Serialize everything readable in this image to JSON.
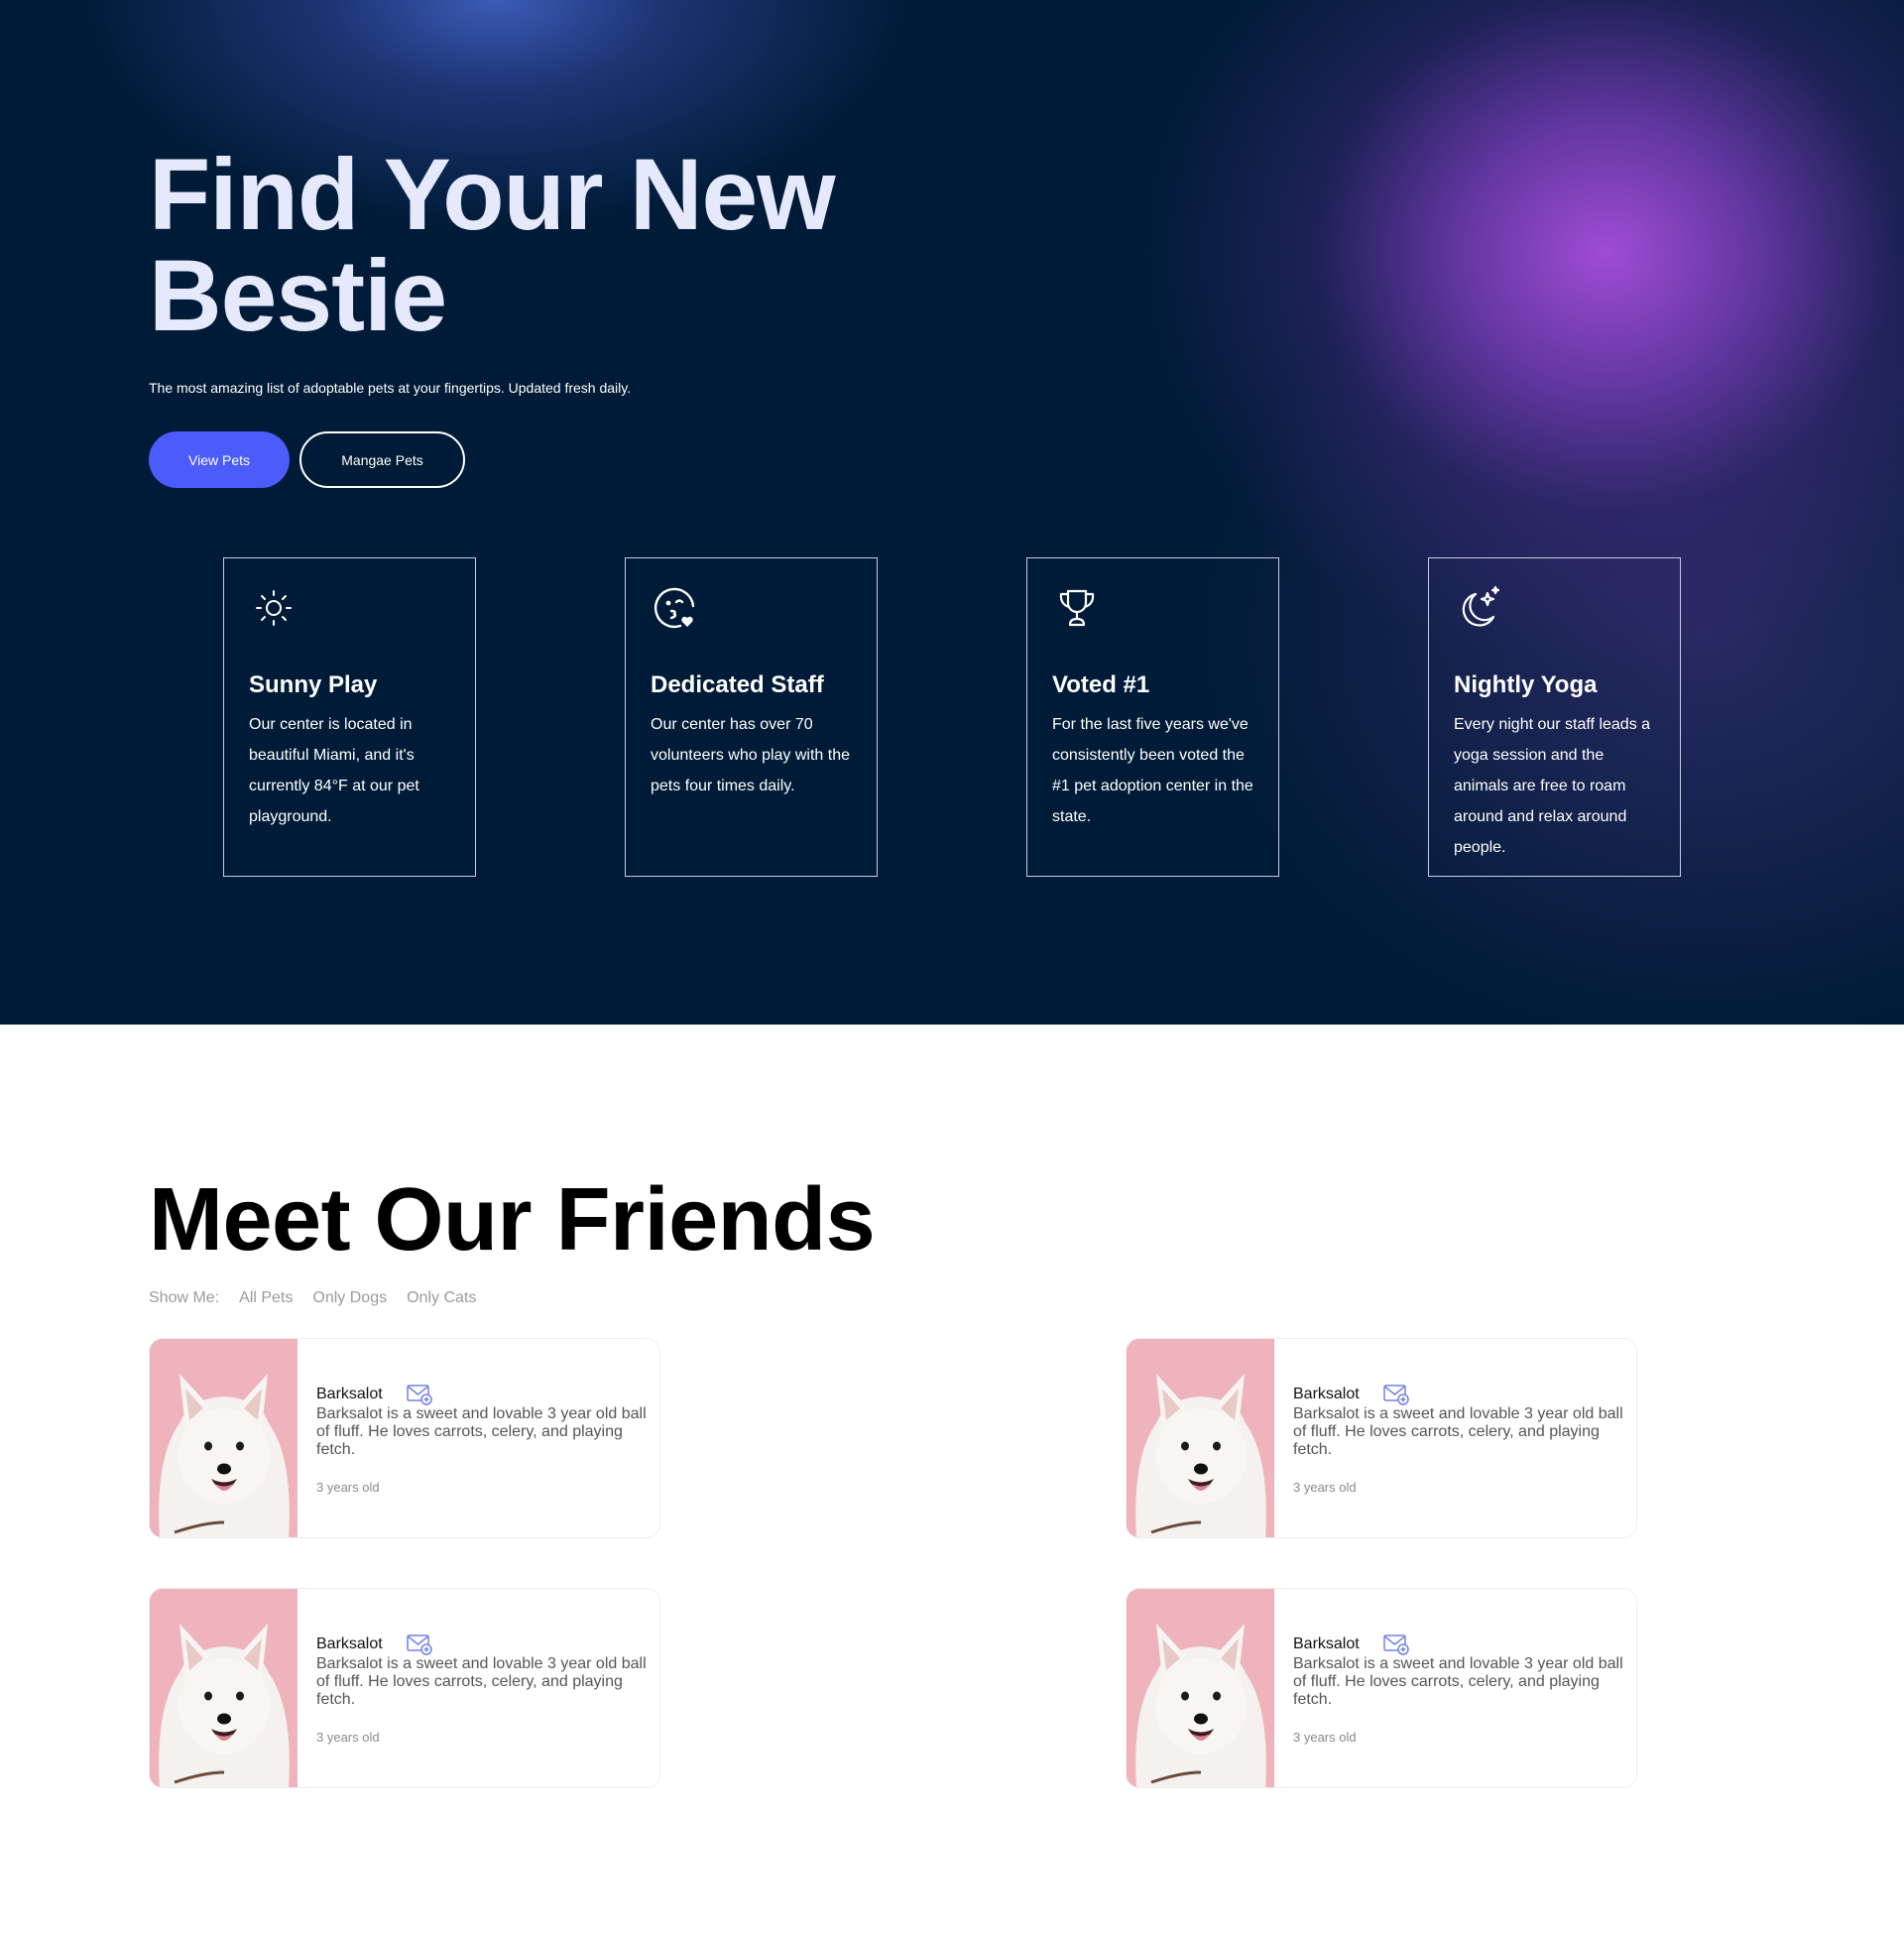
{
  "hero": {
    "title_line1": "Find Your New",
    "title_line2": "Bestie",
    "subtitle": "The most amazing list of adoptable pets at your fingertips. Updated fresh daily.",
    "primary_button": "View Pets",
    "secondary_button": "Mangae Pets"
  },
  "features": [
    {
      "icon": "sun-icon",
      "title": "Sunny Play",
      "text": "Our center is located in beautiful Miami, and it's currently 84°F at our pet playground."
    },
    {
      "icon": "kiss-heart-face-icon",
      "title": "Dedicated Staff",
      "text": "Our center has over 70 volunteers who play with the pets four times daily."
    },
    {
      "icon": "trophy-icon",
      "title": "Voted #1",
      "text": "For the last five years we've consistently been voted the #1 pet adoption center in the state."
    },
    {
      "icon": "moon-stars-icon",
      "title": "Nightly Yoga",
      "text": "Every night our staff leads a yoga session and the animals are free to roam around and relax around people."
    }
  ],
  "friends": {
    "title": "Meet Our Friends",
    "filter_label": "Show Me:",
    "filters": [
      "All Pets",
      "Only Dogs",
      "Only Cats"
    ]
  },
  "pets": [
    {
      "name": "Barksalot",
      "description": "Barksalot is a sweet and lovable 3 year old ball of fluff. He loves carrots, celery, and playing fetch.",
      "age": "3 years old",
      "icon": "mail-add-icon"
    },
    {
      "name": "Barksalot",
      "description": "Barksalot is a sweet and lovable 3 year old ball of fluff. He loves carrots, celery, and playing fetch.",
      "age": "3 years old",
      "icon": "mail-add-icon"
    },
    {
      "name": "Barksalot",
      "description": "Barksalot is a sweet and lovable 3 year old ball of fluff. He loves carrots, celery, and playing fetch.",
      "age": "3 years old",
      "icon": "mail-add-icon"
    },
    {
      "name": "Barksalot",
      "description": "Barksalot is a sweet and lovable 3 year old ball of fluff. He loves carrots, celery, and playing fetch.",
      "age": "3 years old",
      "icon": "mail-add-icon"
    }
  ],
  "colors": {
    "hero_bg": "#001b37",
    "accent": "#4b5bfc",
    "glow_purple": "#a34dd6",
    "glow_blue": "#405ebe",
    "title_light": "#e6e9fb"
  }
}
